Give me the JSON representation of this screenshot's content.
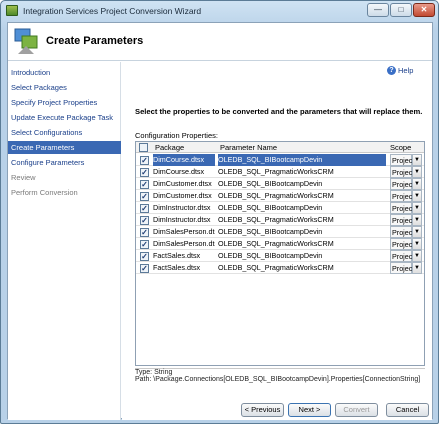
{
  "window": {
    "title": "Integration Services Project Conversion Wizard",
    "controls": {
      "minimize": "—",
      "maximize": "□",
      "close": "✕"
    }
  },
  "header": {
    "title": "Create Parameters",
    "icon": "wizard-icon"
  },
  "sidebar": {
    "items": [
      {
        "label": "Introduction",
        "state": "normal"
      },
      {
        "label": "Select Packages",
        "state": "normal"
      },
      {
        "label": "Specify Project Properties",
        "state": "normal"
      },
      {
        "label": "Update Execute Package Task",
        "state": "normal"
      },
      {
        "label": "Select Configurations",
        "state": "normal"
      },
      {
        "label": "Create Parameters",
        "state": "active"
      },
      {
        "label": "Configure Parameters",
        "state": "normal"
      },
      {
        "label": "Review",
        "state": "disabled"
      },
      {
        "label": "Perform Conversion",
        "state": "disabled"
      }
    ]
  },
  "main": {
    "help_label": "Help",
    "help_icon": "?",
    "instruction": "Select the properties to be converted and the parameters that will replace them.",
    "config_label": "Configuration Properties:",
    "columns": {
      "package": "Package",
      "parameter": "Parameter Name",
      "scope": "Scope"
    },
    "rows": [
      {
        "checked": true,
        "package": "DimCourse.dtsx",
        "parameter": "OLEDB_SQL_BIBootcampDevin",
        "scope": "Project",
        "selected": true
      },
      {
        "checked": true,
        "package": "DimCourse.dtsx",
        "parameter": "OLEDB_SQL_PragmaticWorksCRM",
        "scope": "Project",
        "selected": false
      },
      {
        "checked": true,
        "package": "DimCustomer.dtsx",
        "parameter": "OLEDB_SQL_BIBootcampDevin",
        "scope": "Project",
        "selected": false
      },
      {
        "checked": true,
        "package": "DimCustomer.dtsx",
        "parameter": "OLEDB_SQL_PragmaticWorksCRM",
        "scope": "Project",
        "selected": false
      },
      {
        "checked": true,
        "package": "DimInstructor.dtsx",
        "parameter": "OLEDB_SQL_BIBootcampDevin",
        "scope": "Project",
        "selected": false
      },
      {
        "checked": true,
        "package": "DimInstructor.dtsx",
        "parameter": "OLEDB_SQL_PragmaticWorksCRM",
        "scope": "Project",
        "selected": false
      },
      {
        "checked": true,
        "package": "DimSalesPerson.dtsx",
        "parameter": "OLEDB_SQL_BIBootcampDevin",
        "scope": "Project",
        "selected": false
      },
      {
        "checked": true,
        "package": "DimSalesPerson.dtsx",
        "parameter": "OLEDB_SQL_PragmaticWorksCRM",
        "scope": "Project",
        "selected": false
      },
      {
        "checked": true,
        "package": "FactSales.dtsx",
        "parameter": "OLEDB_SQL_BIBootcampDevin",
        "scope": "Project",
        "selected": false
      },
      {
        "checked": true,
        "package": "FactSales.dtsx",
        "parameter": "OLEDB_SQL_PragmaticWorksCRM",
        "scope": "Project",
        "selected": false
      }
    ],
    "details": {
      "type": "Type: String",
      "path": "Path: \\Package.Connections[OLEDB_SQL_BIBootcampDevin].Properties[ConnectionString]"
    }
  },
  "footer": {
    "back": "< Previous",
    "next": "Next >",
    "convert": "Convert",
    "cancel": "Cancel"
  }
}
